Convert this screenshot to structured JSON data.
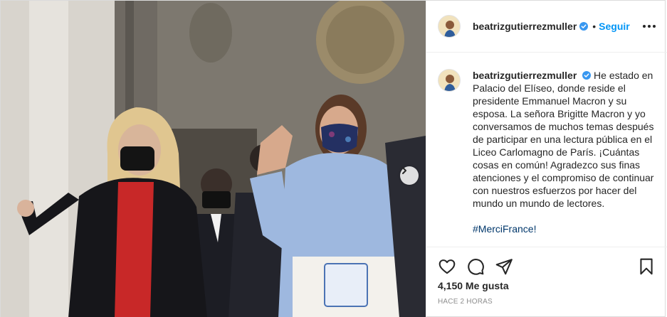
{
  "post": {
    "username": "beatrizgutierrezmuller",
    "verified": true,
    "follow_label": "Seguir",
    "separator": "•",
    "caption": "He estado en Palacio del Elíseo, donde reside el presidente Emmanuel Macron y su esposa. La señora Brigitte Macron y yo conversamos de muchos temas después de participar en una lectura pública en el Liceo Carlomagno de París. ¡Cuántas cosas en común! Agradezco sus finas atenciones y el compromiso de continuar con nuestros esfuerzos por hacer del mundo un mundo de lectores.",
    "hashtag": "#MerciFrance!",
    "likes": "4,150 Me gusta",
    "timestamp": "HACE 2 HORAS"
  },
  "icons": {
    "verified": "verified-badge-icon",
    "more": "more-options-icon",
    "like": "heart-icon",
    "comment": "comment-icon",
    "share": "share-icon",
    "save": "bookmark-icon",
    "next": "chevron-right-icon"
  },
  "colors": {
    "link_blue": "#0095f6",
    "hashtag_blue": "#00376b",
    "text": "#262626",
    "muted": "#8e8e8e",
    "border": "#dbdbdb"
  }
}
